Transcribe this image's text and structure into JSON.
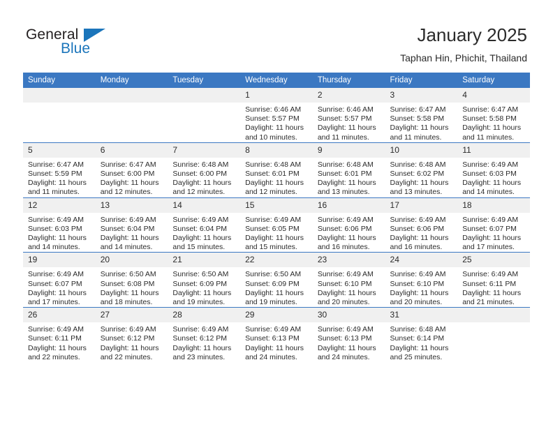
{
  "brand": {
    "name_part1": "General",
    "name_part2": "Blue",
    "triangle_color": "#1b75bb"
  },
  "header": {
    "title": "January 2025",
    "subtitle": "Taphan Hin, Phichit, Thailand",
    "header_bg_color": "#3b78c2",
    "daynum_bg_color": "#f0f0f0"
  },
  "calendar": {
    "weekdays": [
      "Sunday",
      "Monday",
      "Tuesday",
      "Wednesday",
      "Thursday",
      "Friday",
      "Saturday"
    ],
    "weeks": [
      [
        {
          "day": "",
          "blank": true,
          "sunrise": "",
          "sunset": "",
          "daylight1": "",
          "daylight2": ""
        },
        {
          "day": "",
          "blank": true,
          "sunrise": "",
          "sunset": "",
          "daylight1": "",
          "daylight2": ""
        },
        {
          "day": "",
          "blank": true,
          "sunrise": "",
          "sunset": "",
          "daylight1": "",
          "daylight2": ""
        },
        {
          "day": "1",
          "blank": false,
          "sunrise": "Sunrise: 6:46 AM",
          "sunset": "Sunset: 5:57 PM",
          "daylight1": "Daylight: 11 hours",
          "daylight2": "and 10 minutes."
        },
        {
          "day": "2",
          "blank": false,
          "sunrise": "Sunrise: 6:46 AM",
          "sunset": "Sunset: 5:57 PM",
          "daylight1": "Daylight: 11 hours",
          "daylight2": "and 11 minutes."
        },
        {
          "day": "3",
          "blank": false,
          "sunrise": "Sunrise: 6:47 AM",
          "sunset": "Sunset: 5:58 PM",
          "daylight1": "Daylight: 11 hours",
          "daylight2": "and 11 minutes."
        },
        {
          "day": "4",
          "blank": false,
          "sunrise": "Sunrise: 6:47 AM",
          "sunset": "Sunset: 5:58 PM",
          "daylight1": "Daylight: 11 hours",
          "daylight2": "and 11 minutes."
        }
      ],
      [
        {
          "day": "5",
          "blank": false,
          "sunrise": "Sunrise: 6:47 AM",
          "sunset": "Sunset: 5:59 PM",
          "daylight1": "Daylight: 11 hours",
          "daylight2": "and 11 minutes."
        },
        {
          "day": "6",
          "blank": false,
          "sunrise": "Sunrise: 6:47 AM",
          "sunset": "Sunset: 6:00 PM",
          "daylight1": "Daylight: 11 hours",
          "daylight2": "and 12 minutes."
        },
        {
          "day": "7",
          "blank": false,
          "sunrise": "Sunrise: 6:48 AM",
          "sunset": "Sunset: 6:00 PM",
          "daylight1": "Daylight: 11 hours",
          "daylight2": "and 12 minutes."
        },
        {
          "day": "8",
          "blank": false,
          "sunrise": "Sunrise: 6:48 AM",
          "sunset": "Sunset: 6:01 PM",
          "daylight1": "Daylight: 11 hours",
          "daylight2": "and 12 minutes."
        },
        {
          "day": "9",
          "blank": false,
          "sunrise": "Sunrise: 6:48 AM",
          "sunset": "Sunset: 6:01 PM",
          "daylight1": "Daylight: 11 hours",
          "daylight2": "and 13 minutes."
        },
        {
          "day": "10",
          "blank": false,
          "sunrise": "Sunrise: 6:48 AM",
          "sunset": "Sunset: 6:02 PM",
          "daylight1": "Daylight: 11 hours",
          "daylight2": "and 13 minutes."
        },
        {
          "day": "11",
          "blank": false,
          "sunrise": "Sunrise: 6:49 AM",
          "sunset": "Sunset: 6:03 PM",
          "daylight1": "Daylight: 11 hours",
          "daylight2": "and 14 minutes."
        }
      ],
      [
        {
          "day": "12",
          "blank": false,
          "sunrise": "Sunrise: 6:49 AM",
          "sunset": "Sunset: 6:03 PM",
          "daylight1": "Daylight: 11 hours",
          "daylight2": "and 14 minutes."
        },
        {
          "day": "13",
          "blank": false,
          "sunrise": "Sunrise: 6:49 AM",
          "sunset": "Sunset: 6:04 PM",
          "daylight1": "Daylight: 11 hours",
          "daylight2": "and 14 minutes."
        },
        {
          "day": "14",
          "blank": false,
          "sunrise": "Sunrise: 6:49 AM",
          "sunset": "Sunset: 6:04 PM",
          "daylight1": "Daylight: 11 hours",
          "daylight2": "and 15 minutes."
        },
        {
          "day": "15",
          "blank": false,
          "sunrise": "Sunrise: 6:49 AM",
          "sunset": "Sunset: 6:05 PM",
          "daylight1": "Daylight: 11 hours",
          "daylight2": "and 15 minutes."
        },
        {
          "day": "16",
          "blank": false,
          "sunrise": "Sunrise: 6:49 AM",
          "sunset": "Sunset: 6:06 PM",
          "daylight1": "Daylight: 11 hours",
          "daylight2": "and 16 minutes."
        },
        {
          "day": "17",
          "blank": false,
          "sunrise": "Sunrise: 6:49 AM",
          "sunset": "Sunset: 6:06 PM",
          "daylight1": "Daylight: 11 hours",
          "daylight2": "and 16 minutes."
        },
        {
          "day": "18",
          "blank": false,
          "sunrise": "Sunrise: 6:49 AM",
          "sunset": "Sunset: 6:07 PM",
          "daylight1": "Daylight: 11 hours",
          "daylight2": "and 17 minutes."
        }
      ],
      [
        {
          "day": "19",
          "blank": false,
          "sunrise": "Sunrise: 6:49 AM",
          "sunset": "Sunset: 6:07 PM",
          "daylight1": "Daylight: 11 hours",
          "daylight2": "and 17 minutes."
        },
        {
          "day": "20",
          "blank": false,
          "sunrise": "Sunrise: 6:50 AM",
          "sunset": "Sunset: 6:08 PM",
          "daylight1": "Daylight: 11 hours",
          "daylight2": "and 18 minutes."
        },
        {
          "day": "21",
          "blank": false,
          "sunrise": "Sunrise: 6:50 AM",
          "sunset": "Sunset: 6:09 PM",
          "daylight1": "Daylight: 11 hours",
          "daylight2": "and 19 minutes."
        },
        {
          "day": "22",
          "blank": false,
          "sunrise": "Sunrise: 6:50 AM",
          "sunset": "Sunset: 6:09 PM",
          "daylight1": "Daylight: 11 hours",
          "daylight2": "and 19 minutes."
        },
        {
          "day": "23",
          "blank": false,
          "sunrise": "Sunrise: 6:49 AM",
          "sunset": "Sunset: 6:10 PM",
          "daylight1": "Daylight: 11 hours",
          "daylight2": "and 20 minutes."
        },
        {
          "day": "24",
          "blank": false,
          "sunrise": "Sunrise: 6:49 AM",
          "sunset": "Sunset: 6:10 PM",
          "daylight1": "Daylight: 11 hours",
          "daylight2": "and 20 minutes."
        },
        {
          "day": "25",
          "blank": false,
          "sunrise": "Sunrise: 6:49 AM",
          "sunset": "Sunset: 6:11 PM",
          "daylight1": "Daylight: 11 hours",
          "daylight2": "and 21 minutes."
        }
      ],
      [
        {
          "day": "26",
          "blank": false,
          "sunrise": "Sunrise: 6:49 AM",
          "sunset": "Sunset: 6:11 PM",
          "daylight1": "Daylight: 11 hours",
          "daylight2": "and 22 minutes."
        },
        {
          "day": "27",
          "blank": false,
          "sunrise": "Sunrise: 6:49 AM",
          "sunset": "Sunset: 6:12 PM",
          "daylight1": "Daylight: 11 hours",
          "daylight2": "and 22 minutes."
        },
        {
          "day": "28",
          "blank": false,
          "sunrise": "Sunrise: 6:49 AM",
          "sunset": "Sunset: 6:12 PM",
          "daylight1": "Daylight: 11 hours",
          "daylight2": "and 23 minutes."
        },
        {
          "day": "29",
          "blank": false,
          "sunrise": "Sunrise: 6:49 AM",
          "sunset": "Sunset: 6:13 PM",
          "daylight1": "Daylight: 11 hours",
          "daylight2": "and 24 minutes."
        },
        {
          "day": "30",
          "blank": false,
          "sunrise": "Sunrise: 6:49 AM",
          "sunset": "Sunset: 6:13 PM",
          "daylight1": "Daylight: 11 hours",
          "daylight2": "and 24 minutes."
        },
        {
          "day": "31",
          "blank": false,
          "sunrise": "Sunrise: 6:48 AM",
          "sunset": "Sunset: 6:14 PM",
          "daylight1": "Daylight: 11 hours",
          "daylight2": "and 25 minutes."
        },
        {
          "day": "",
          "blank": true,
          "sunrise": "",
          "sunset": "",
          "daylight1": "",
          "daylight2": ""
        }
      ]
    ]
  }
}
